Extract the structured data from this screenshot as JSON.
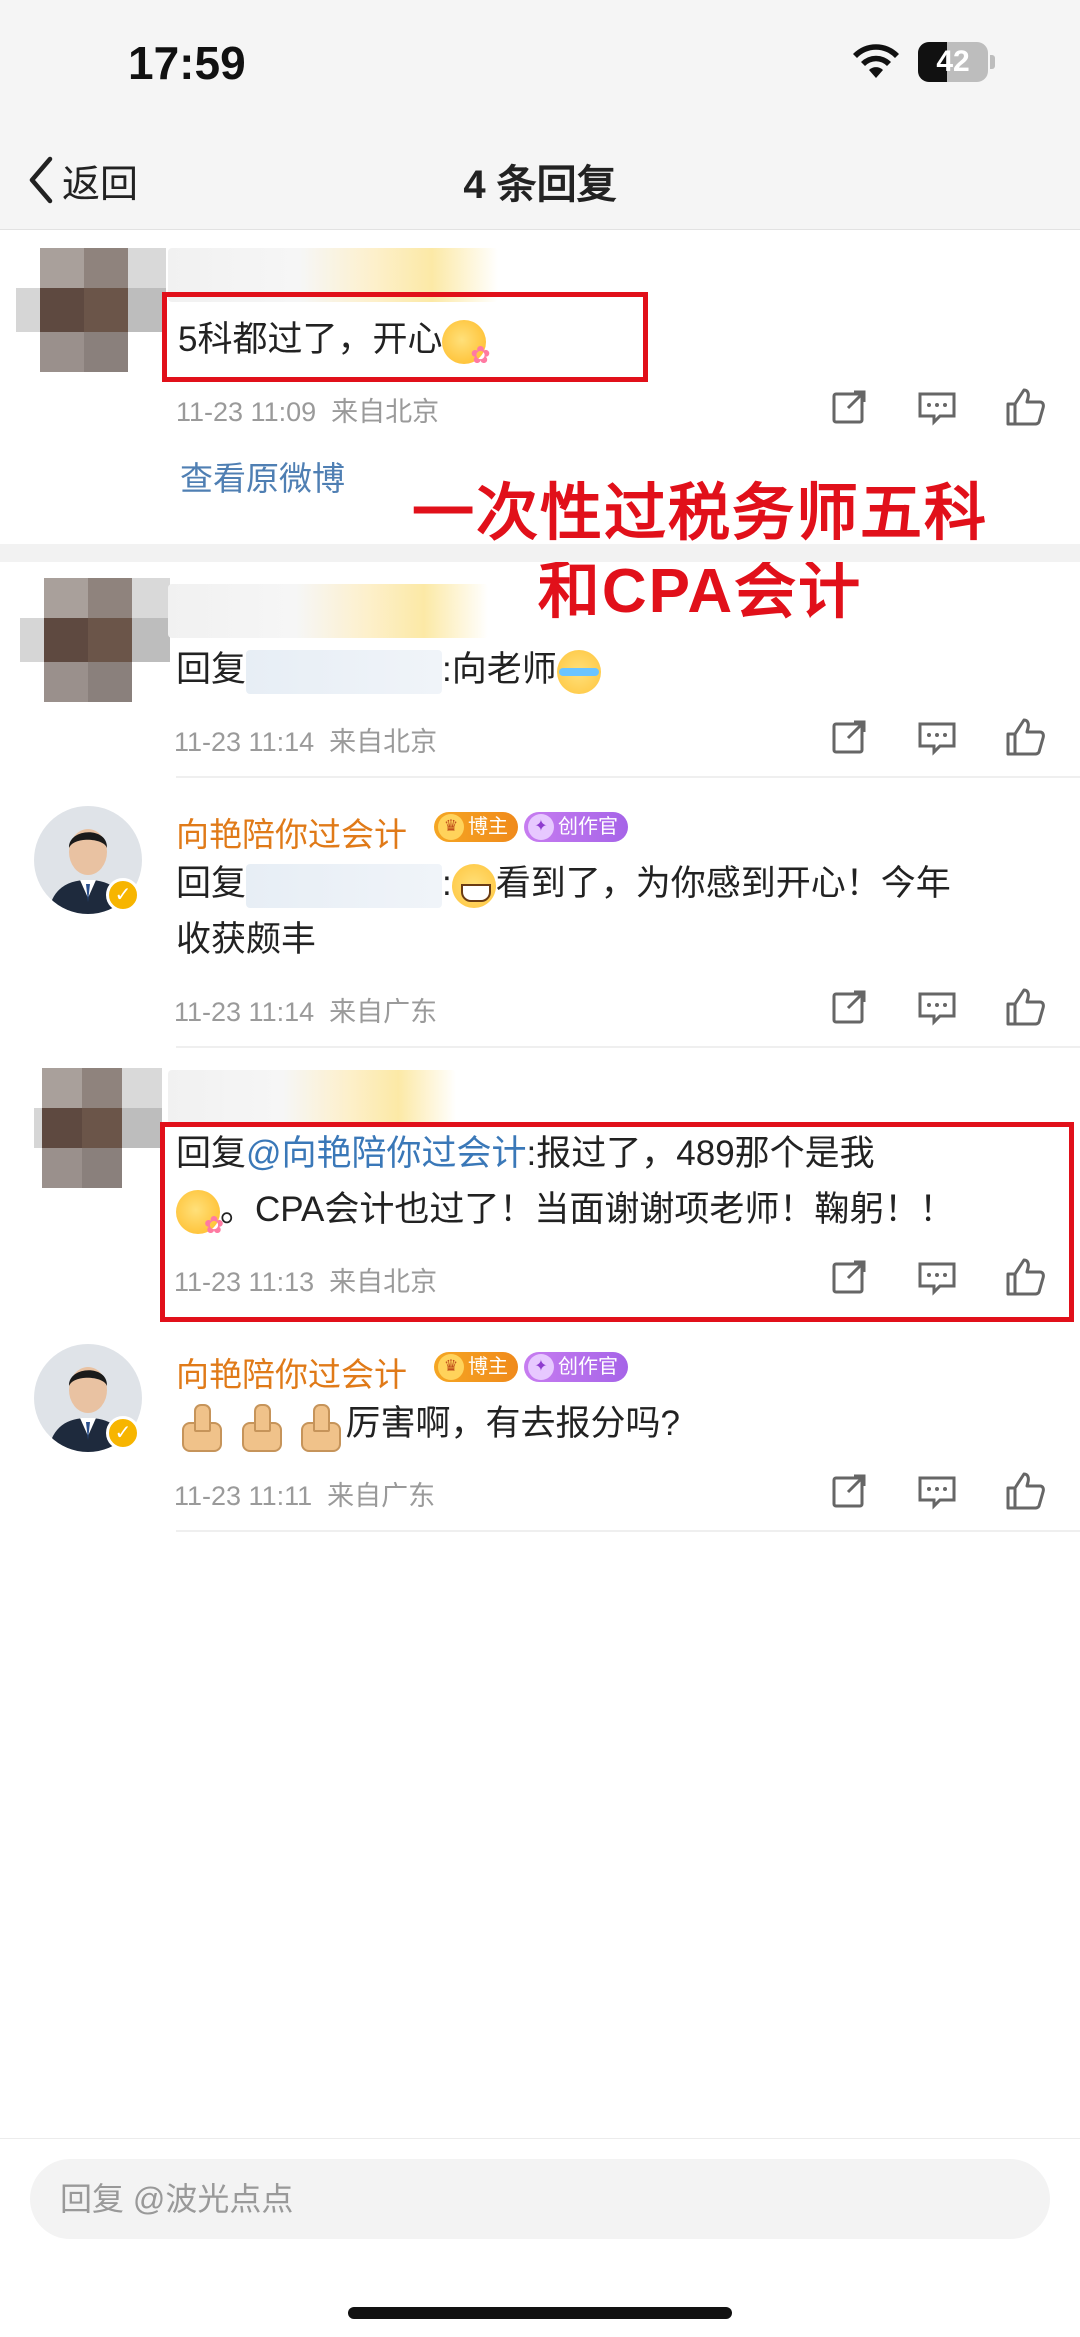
{
  "status_bar": {
    "time": "17:59",
    "battery": "42",
    "battery_level": 0.42
  },
  "nav": {
    "back_label": "返回",
    "title": "4 条回复"
  },
  "root_comment": {
    "text": "5科都过了，开心",
    "emoji": "flower-face-emoji",
    "time": "11-23 11:09",
    "source": "来自北京",
    "view_original": "查看原微博"
  },
  "overlay": {
    "line1": "一次性过税务师五科",
    "line2": "和CPA会计"
  },
  "replies": [
    {
      "prefix": "回复",
      "suffix": ":向老师",
      "emoji": "laugh-cry-emoji",
      "time": "11-23 11:14",
      "source": "来自北京"
    },
    {
      "name": "向艳陪你过会计",
      "badge1": "博主",
      "badge2": "创作官",
      "prefix": "回复",
      "suffix_text": "看到了，为你感到开心！今年",
      "line2": "收获颇丰",
      "emoji": "grin-emoji",
      "time": "11-23 11:14",
      "source": "来自广东"
    },
    {
      "prefix": "回复",
      "mention": "@向艳陪你过会计",
      "text1": ":报过了，489那个是我",
      "text2": "。CPA会计也过了！当面谢谢项老师！鞠躬！！",
      "emoji": "flower-face-emoji",
      "time": "11-23 11:13",
      "source": "来自北京"
    },
    {
      "name": "向艳陪你过会计",
      "badge1": "博主",
      "badge2": "创作官",
      "text": "厉害啊，有去报分吗?",
      "emoji": "thumbs-up-emoji",
      "time": "11-23 11:11",
      "source": "来自广东"
    }
  ],
  "input": {
    "placeholder": "回复 @波光点点"
  },
  "colors": {
    "accent_red": "#e1101a",
    "name_orange": "#e07a18",
    "link_blue": "#3a78b8"
  }
}
